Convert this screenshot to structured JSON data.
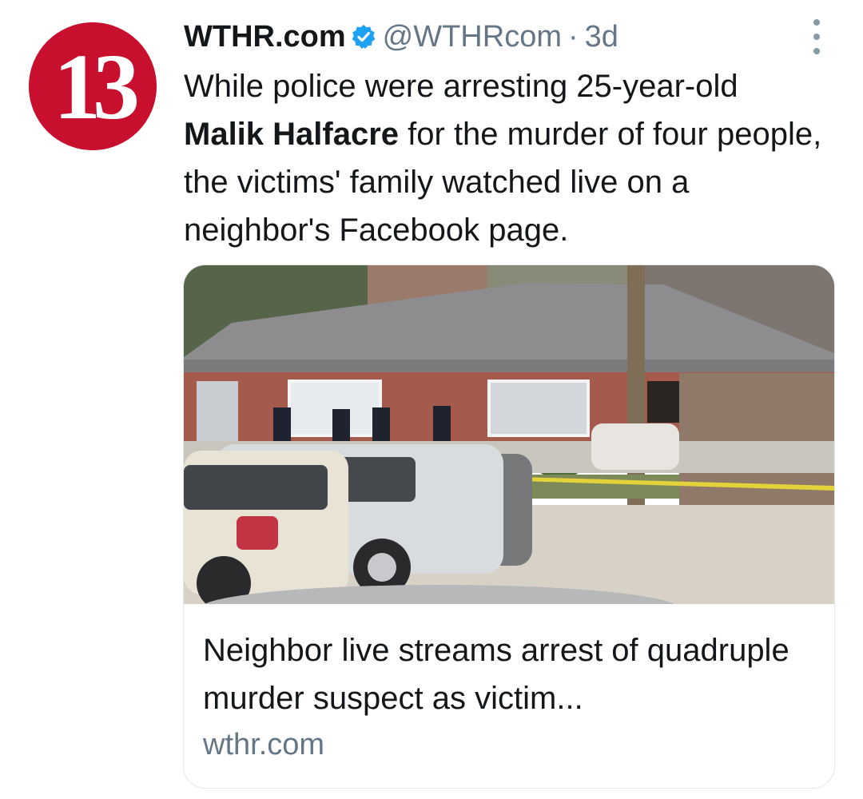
{
  "tweet": {
    "avatar": {
      "logo_text": "13",
      "icon": "station-logo-icon",
      "brand_color": "#c8102e"
    },
    "author": {
      "display_name": "WTHR.com",
      "verified_icon": "verified-badge-icon",
      "handle": "@WTHRcom",
      "separator": "·",
      "time": "3d"
    },
    "more_icon": "more-options-icon",
    "text": {
      "part1": "While police were arresting 25-year-old ",
      "bold_name": "Malik Halfacre",
      "part2": " for the murder of four people, the victims' family watched live on a neighbor's Facebook page."
    },
    "card": {
      "image_icon": "news-photo-image",
      "title": "Neighbor live streams arrest of quadruple murder suspect as victim...",
      "domain": "wthr.com"
    }
  },
  "colors": {
    "text_primary": "#14171a",
    "text_secondary": "#657786",
    "verified_blue": "#1da1f2",
    "card_border": "#e1e8ed"
  }
}
